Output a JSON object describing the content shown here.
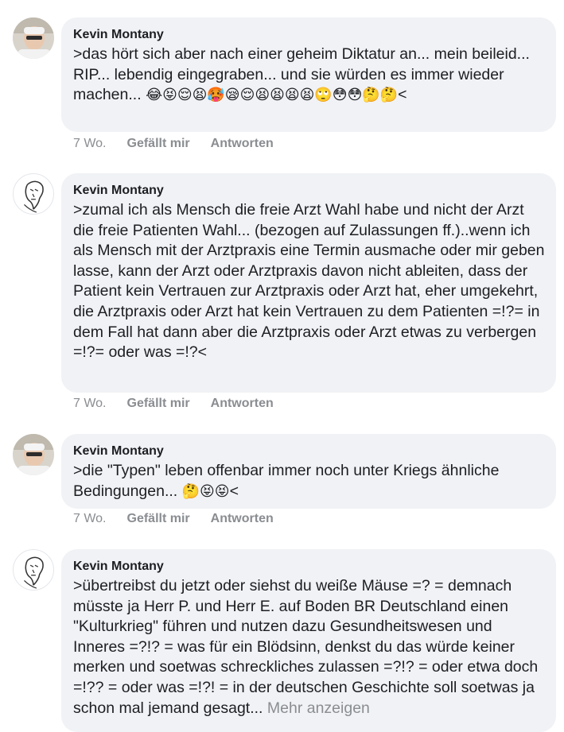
{
  "comments": [
    {
      "author": "Kevin Montany",
      "text": ">das hört sich aber nach einer geheim Diktatur an... mein beileid... RIP... lebendig eingegraben... und sie würden es immer wieder machen...",
      "emojis": "😂😝😌😫🥵😪😌😫😫😫😫🙄😳😳🤔🤔",
      "suffix": "<",
      "age": "7 Wo.",
      "like": "Gefällt mir",
      "reply": "Antworten"
    },
    {
      "author": "Kevin Montany",
      "text": ">zumal ich als Mensch die freie Arzt Wahl habe und nicht der Arzt die freie Patienten Wahl... (bezogen auf Zulassungen ff.)..wenn ich als Mensch mit der Arztpraxis eine Termin ausmache oder mir geben lasse, kann der Arzt oder Arztpraxis davon nicht ableiten, dass der Patient kein Vertrauen zur Arztpraxis oder Arzt hat, eher umgekehrt, die Arztpraxis oder Arzt hat kein Vertrauen zu dem Patienten =!?= in dem Fall hat dann aber die Arztpraxis oder Arzt etwas zu verbergen =!?= oder was =!?<",
      "age": "7 Wo.",
      "like": "Gefällt mir",
      "reply": "Antworten"
    },
    {
      "author": "Kevin Montany",
      "text": ">die \"Typen\" leben offenbar immer noch unter Kriegs ähnliche Bedingungen...",
      "emojis": "🤔😝😝",
      "suffix": "<",
      "age": "7 Wo.",
      "like": "Gefällt mir",
      "reply": "Antworten"
    },
    {
      "author": "Kevin Montany",
      "text": ">übertreibst du jetzt oder siehst du weiße Mäuse =? = demnach müsste ja Herr P. und Herr E. auf Boden BR Deutschland einen \"Kulturkrieg\" führen und nutzen dazu Gesundheitswesen und Inneres =?!? = was für ein Blödsinn, denkst du das würde keiner merken und soetwas schreckliches zulassen =?!? = oder etwa doch =!?? = oder was =!?! = in der deutschen Geschichte soll soetwas ja schon mal jemand gesagt...",
      "more": "Mehr anzeigen"
    }
  ]
}
